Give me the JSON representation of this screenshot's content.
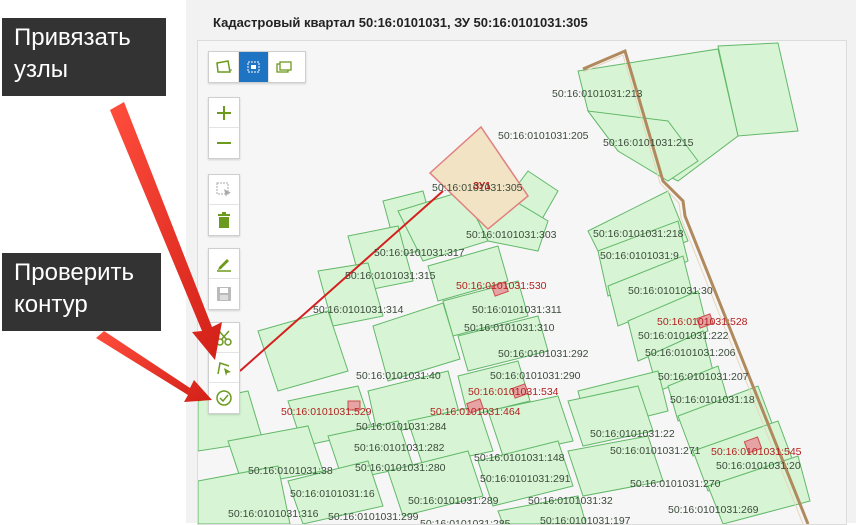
{
  "title": "Кадастровый квартал 50:16:0101031, ЗУ 50:16:0101031:305",
  "callouts": {
    "snap": "Привязать\nузлы",
    "check": "Проверить\nконтур"
  },
  "toolbar": {
    "draw_modes": [
      {
        "icon": "draw-polygon-icon",
        "active": false
      },
      {
        "icon": "select-area-icon",
        "active": true
      },
      {
        "icon": "copy-contour-icon",
        "active": false
      }
    ],
    "zoom": [
      {
        "icon": "zoom-in-icon"
      },
      {
        "icon": "zoom-out-icon"
      }
    ],
    "selection": [
      {
        "icon": "select-node-icon"
      },
      {
        "icon": "delete-icon"
      }
    ],
    "edit": [
      {
        "icon": "edit-icon"
      },
      {
        "icon": "save-icon"
      }
    ],
    "tools": [
      {
        "icon": "cut-icon"
      },
      {
        "icon": "snap-nodes-icon"
      },
      {
        "icon": "check-contour-icon"
      }
    ]
  },
  "map": {
    "zu_label": "ЗУ1",
    "parcel_fill": "#d7f5d4",
    "parcel_stroke": "#63b86a",
    "boundary_color": "#b08a5e",
    "highlight_fill": "#f2e3c4",
    "line_color": "#d51f1f",
    "parcels": [
      {
        "text": "50:16:0101031:213",
        "red": false
      },
      {
        "text": "50:16:0101031:205",
        "red": false
      },
      {
        "text": "50:16:0101031:215",
        "red": false
      },
      {
        "text": "50:16:0101031:305",
        "red": false
      },
      {
        "text": "50:16:0101031:303",
        "red": false
      },
      {
        "text": "50:16:0101031:218",
        "red": false
      },
      {
        "text": "50:16:0101031:9",
        "red": false
      },
      {
        "text": "50:16:0101031:317",
        "red": false
      },
      {
        "text": "50:16:0101031:315",
        "red": false
      },
      {
        "text": "50:16:0101031:530",
        "red": true
      },
      {
        "text": "50:16:0101031:30",
        "red": false
      },
      {
        "text": "50:16:0101031:314",
        "red": false
      },
      {
        "text": "50:16:0101031:311",
        "red": false
      },
      {
        "text": "50:16:0101031:528",
        "red": true
      },
      {
        "text": "50:16:0101031:310",
        "red": false
      },
      {
        "text": "50:16:0101031:222",
        "red": false
      },
      {
        "text": "50:16:0101031:292",
        "red": false
      },
      {
        "text": "50:16:0101031:206",
        "red": false
      },
      {
        "text": "50:16:0101031:290",
        "red": false
      },
      {
        "text": "50:16:0101031:40",
        "red": false
      },
      {
        "text": "50:16:0101031:207",
        "red": false
      },
      {
        "text": "50:16:0101031:534",
        "red": true
      },
      {
        "text": "50:16:0101031:18",
        "red": false
      },
      {
        "text": "50:16:0101031:529",
        "red": true
      },
      {
        "text": "50:16:0101031:464",
        "red": true
      },
      {
        "text": "50:16:0101031:284",
        "red": false
      },
      {
        "text": "50:16:0101031:22",
        "red": false
      },
      {
        "text": "50:16:0101031:282",
        "red": false
      },
      {
        "text": "50:16:0101031:148",
        "red": false
      },
      {
        "text": "50:16:0101031:271",
        "red": false
      },
      {
        "text": "50:16:0101031:545",
        "red": true
      },
      {
        "text": "50:16:0101031:38",
        "red": false
      },
      {
        "text": "50:16:0101031:280",
        "red": false
      },
      {
        "text": "50:16:0101031:20",
        "red": false
      },
      {
        "text": "50:16:0101031:291",
        "red": false
      },
      {
        "text": "50:16:0101031:270",
        "red": false
      },
      {
        "text": "50:16:0101031:16",
        "red": false
      },
      {
        "text": "50:16:0101031:289",
        "red": false
      },
      {
        "text": "50:16:0101031:32",
        "red": false
      },
      {
        "text": "50:16:0101031:269",
        "red": false
      },
      {
        "text": "50:16:0101031:316",
        "red": false
      },
      {
        "text": "50:16:0101031:299",
        "red": false
      },
      {
        "text": "50:16:0101031:285",
        "red": false
      },
      {
        "text": "50:16:0101031:197",
        "red": false
      }
    ]
  }
}
